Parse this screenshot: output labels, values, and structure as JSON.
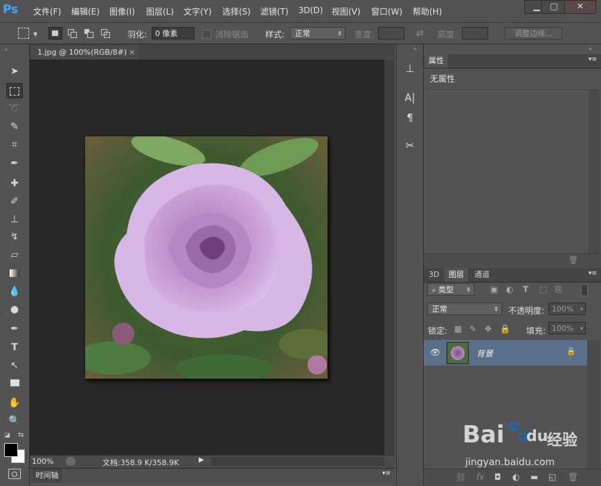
{
  "app": {
    "logo": "Ps",
    "menu": [
      "文件(F)",
      "编辑(E)",
      "图像(I)",
      "图层(L)",
      "文字(Y)",
      "选择(S)",
      "滤镜(T)",
      "3D(D)",
      "视图(V)",
      "窗口(W)",
      "帮助(H)"
    ],
    "window_buttons": {
      "minimize": "▁",
      "maximize": "□",
      "close": "✕"
    }
  },
  "options_bar": {
    "feather_label": "羽化:",
    "feather_value": "0 像素",
    "antialias_label": "消除锯齿",
    "style_label": "样式:",
    "style_value": "正常",
    "width_label": "宽度:",
    "height_label": "高度:",
    "refine_edge_label": "调整边缘..."
  },
  "document": {
    "tab_title": "1.jpg @ 100%(RGB/8#)",
    "tab_close": "×",
    "zoom": "100%",
    "doc_info": "文档:358.9 K/358.9K",
    "timeline_label": "时间轴"
  },
  "properties_panel": {
    "tab": "属性",
    "content": "无属性"
  },
  "layers_panel": {
    "tabs": [
      "3D",
      "图层",
      "通道"
    ],
    "filter_label": "类型",
    "blend_mode": "正常",
    "opacity_label": "不透明度:",
    "opacity_value": "100%",
    "lock_label": "锁定:",
    "fill_label": "填充:",
    "fill_value": "100%",
    "layer_name": "背景"
  },
  "watermark": {
    "brand": "Bai",
    "brand2": "du",
    "cn": "经验",
    "url": "jingyan.baidu.com"
  },
  "colors": {
    "accent": "#3ea8ff",
    "selected_layer": "#5c6f8a",
    "canvas_bg": "#282828"
  }
}
